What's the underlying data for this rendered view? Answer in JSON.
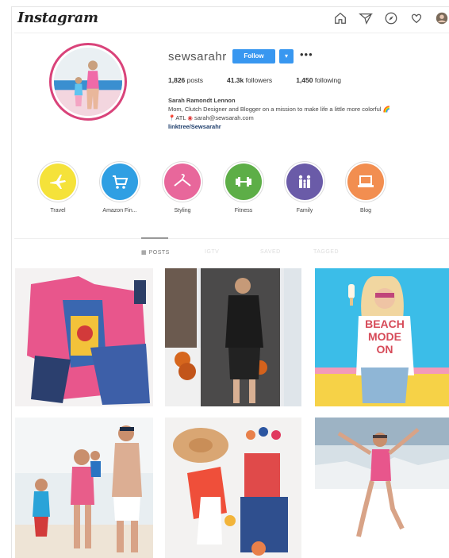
{
  "app": {
    "logo_text": "Instagram"
  },
  "nav": {
    "icons": [
      "home-icon",
      "direct-icon",
      "explore-icon",
      "activity-icon",
      "profile-icon"
    ]
  },
  "profile": {
    "username": "sewsarahr",
    "follow_label": "Follow",
    "dropdown_label": "▾",
    "more_label": "•••",
    "stats": {
      "posts": "1,826",
      "posts_label": "posts",
      "followers": "41.3k",
      "followers_label": "followers",
      "following": "1,450",
      "following_label": "following"
    },
    "bio": {
      "name": "Sarah Ramondt Lennon",
      "line1": "Mom, Clutch Designer and Blogger on a mission to make life a little more colorful 🌈",
      "pin": "📍",
      "location": "ATL",
      "email_label": "sarah@sewsarah.com",
      "link": "linktree/Sewsarahr"
    }
  },
  "highlights": [
    {
      "label": "Travel",
      "color": "#f5e23a",
      "icon": "airplane-icon"
    },
    {
      "label": "Amazon Fin...",
      "color": "#2f9fe3",
      "icon": "cart-icon"
    },
    {
      "label": "Styling",
      "color": "#e8679b",
      "icon": "hanger-icon"
    },
    {
      "label": "Fitness",
      "color": "#5dae47",
      "icon": "dumbbell-icon"
    },
    {
      "label": "Family",
      "color": "#6a5ba8",
      "icon": "family-icon"
    },
    {
      "label": "Blog",
      "color": "#f28e50",
      "icon": "laptop-icon"
    }
  ],
  "tabs": [
    {
      "label": "POSTS",
      "active": true
    },
    {
      "label": "IGTV",
      "active": false
    },
    {
      "label": "SAVED",
      "active": false
    },
    {
      "label": "TAGGED",
      "active": false
    }
  ],
  "colors": {
    "follow_blue": "#3897f0",
    "ring_pink": "#d9437a"
  }
}
